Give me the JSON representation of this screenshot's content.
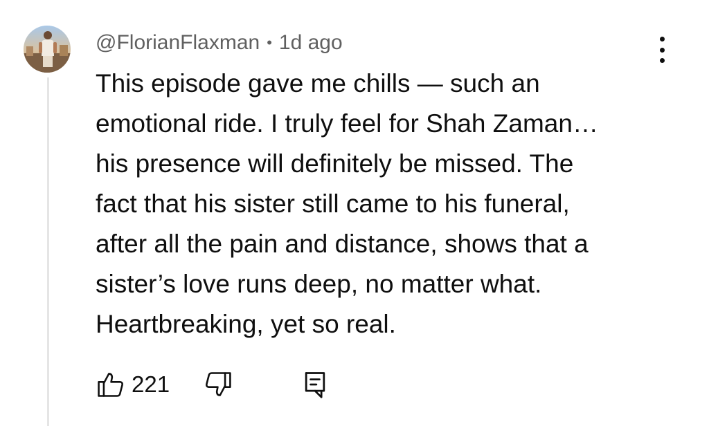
{
  "comment": {
    "author": "@FlorianFlaxman",
    "separator": "•",
    "time_ago": "1d ago",
    "lines": [
      "This episode gave me chills — such an",
      "emotional ride. I truly feel for Shah Zaman…",
      "his presence will definitely be missed. The",
      "fact that his sister still came to his funeral,",
      "after all the pain and distance, shows that a",
      "sister’s love runs deep, no matter what.",
      "Heartbreaking, yet so real."
    ]
  },
  "actions": {
    "like_count": "221",
    "like_icon": "thumbs-up-icon",
    "dislike_icon": "thumbs-down-icon",
    "reply_icon": "reply-comment-icon"
  },
  "menu_icon": "more-vertical-icon",
  "colors": {
    "text_primary": "#0f0f0f",
    "text_secondary": "#606060",
    "thread_line": "#e5e5e5",
    "background": "#ffffff"
  }
}
